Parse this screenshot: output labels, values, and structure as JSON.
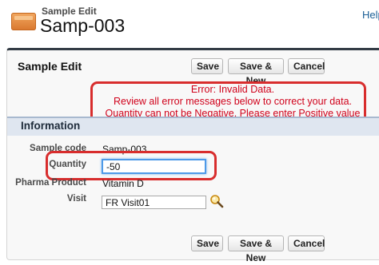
{
  "header": {
    "object_label": "Sample Edit",
    "record_name": "Samp-003",
    "help_text": "Help"
  },
  "panel": {
    "title": "Sample Edit",
    "buttons": {
      "save": "Save",
      "save_new": "Save & New",
      "cancel": "Cancel"
    }
  },
  "error": {
    "line1": "Error: Invalid Data.",
    "line2": "Review all error messages below to correct your data.",
    "line3": "Quantity can not be Negative. Please enter Positive value"
  },
  "section": {
    "title": "Information",
    "fields": {
      "sample_code": {
        "label": "Sample code",
        "value": "Samp-003"
      },
      "quantity": {
        "label": "Quantity",
        "value": "-50"
      },
      "pharma_product": {
        "label": "Pharma Product",
        "value": "Vitamin D"
      },
      "visit": {
        "label": "Visit",
        "value": "FR Visit01"
      }
    }
  },
  "colors": {
    "error": "#d0021b",
    "highlight": "#d82d2d",
    "accent": "#1a5e96"
  },
  "icons": {
    "header": "sample-object-icon",
    "lookup": "lookup-search-icon"
  }
}
